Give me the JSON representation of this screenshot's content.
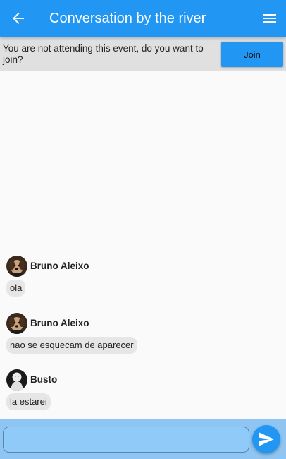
{
  "header": {
    "title": "Conversation by the river",
    "back_icon": "arrow-back-icon",
    "menu_icon": "hamburger-menu-icon"
  },
  "banner": {
    "message": "You are not attending this event, do you want to join?",
    "join_label": "Join"
  },
  "messages": [
    {
      "sender": "Bruno Aleixo",
      "text": "ola",
      "avatar_icon": "dog-avatar-icon"
    },
    {
      "sender": "Bruno Aleixo",
      "text": "nao se esquecam de aparecer",
      "avatar_icon": "dog-avatar-icon"
    },
    {
      "sender": "Busto",
      "text": "la estarei",
      "avatar_icon": "bust-avatar-icon"
    }
  ],
  "composer": {
    "value": "",
    "placeholder": "",
    "send_icon": "send-icon"
  },
  "colors": {
    "primary": "#2196f3",
    "banner_bg": "#e0e0e0",
    "composer_bg": "#8ec5f3",
    "bubble_bg": "#e6e6e6"
  }
}
